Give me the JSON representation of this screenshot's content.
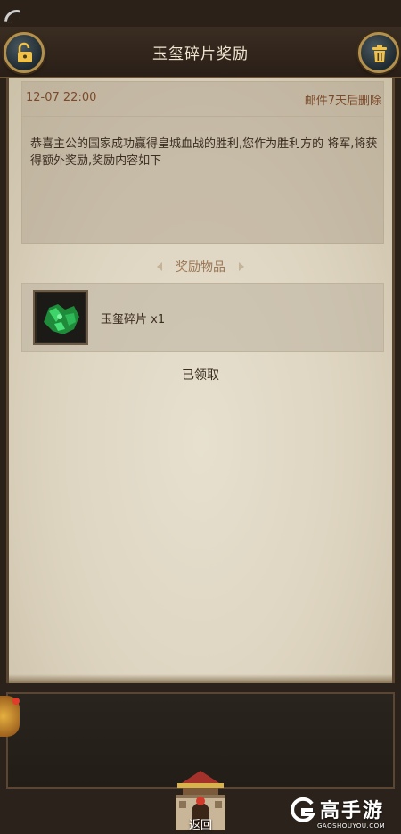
{
  "header": {
    "title": "玉玺碎片奖励"
  },
  "mail": {
    "date": "12-07 22:00",
    "expire_note": "邮件7天后删除",
    "body": "恭喜主公的国家成功赢得皇城血战的胜利,您作为胜利方的 将军,将获得额外奖励,奖励内容如下"
  },
  "rewards": {
    "section_label": "奖励物品",
    "items": [
      {
        "name": "玉玺碎片 x1",
        "icon": "jade-seal-fragment-icon"
      }
    ],
    "status": "已领取"
  },
  "footer": {
    "back_label": "返回"
  },
  "watermark": {
    "title": "高手游",
    "url": "GAOSHOUYOU.COM"
  },
  "colors": {
    "accent_brown": "#7d4a2a",
    "gold_ring": "#b4904d",
    "paper": "#e2dac8"
  }
}
